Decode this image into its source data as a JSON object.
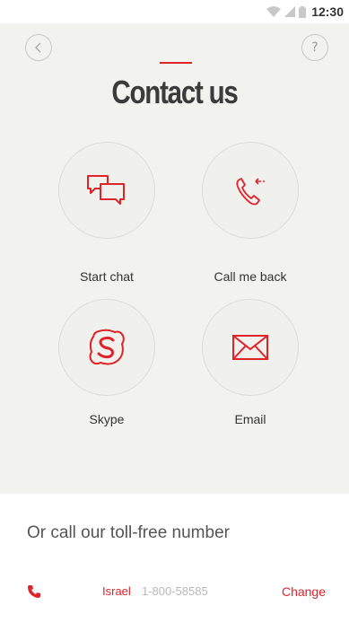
{
  "status_bar": {
    "time": "12:30",
    "icons": [
      "wifi-icon",
      "signal-icon",
      "battery-icon"
    ]
  },
  "header": {
    "back_icon": "chevron-left-icon",
    "help_label": "?",
    "title": "Contact us"
  },
  "options": [
    {
      "label": "Start chat",
      "icon": "chat-icon"
    },
    {
      "label": "Call me back",
      "icon": "callback-icon"
    },
    {
      "label": "Skype",
      "icon": "skype-icon"
    },
    {
      "label": "Email",
      "icon": "email-icon"
    }
  ],
  "footer": {
    "toll_free_text": "Or call our toll-free number",
    "country": "Israel",
    "number": "1-800-58585",
    "change_label": "Change",
    "phone_icon": "phone-icon"
  },
  "colors": {
    "accent": "#e0222a",
    "background": "#f2f2ee",
    "footer_bg": "#ffffff"
  }
}
